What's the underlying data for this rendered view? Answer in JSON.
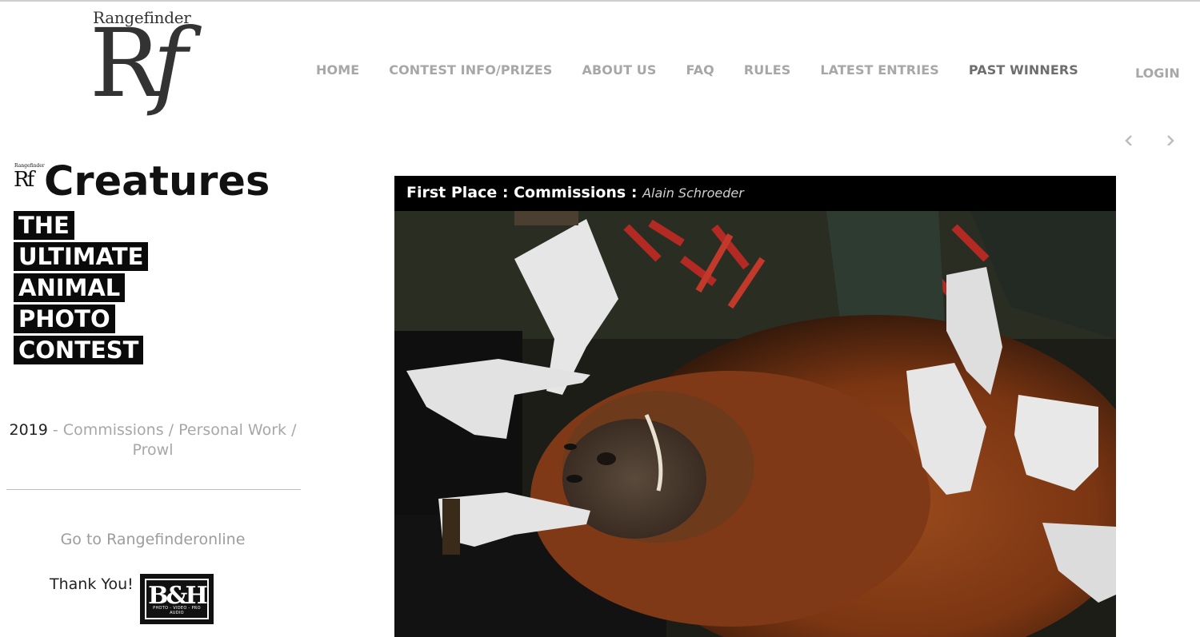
{
  "logo": {
    "word": "Rangefinder",
    "mark_r": "R",
    "mark_f": "f"
  },
  "nav": {
    "items": [
      "HOME",
      "CONTEST INFO/PRIZES",
      "ABOUT US",
      "FAQ",
      "RULES",
      "LATEST ENTRIES",
      "PAST WINNERS"
    ],
    "active": "PAST WINNERS",
    "login": "LOGIN"
  },
  "slider": {
    "prev_icon": "chevron-left-icon",
    "next_icon": "chevron-right-icon"
  },
  "badge": {
    "small_word": "Rangefinder",
    "small_mark": "Rf",
    "title": "Creatures",
    "lines": [
      "THE",
      "ULTIMATE",
      "ANIMAL",
      "PHOTO",
      "CONTEST"
    ]
  },
  "sidebar": {
    "year": "2019",
    "sep": " - ",
    "links": [
      "Commissions",
      "Personal Work",
      "Prowl"
    ],
    "goto": "Go to Rangefinderonline",
    "thanks": "Thank You!",
    "sponsor_logo": "B&H",
    "sponsor_tagline": "PHOTO - VIDEO - PRO AUDIO"
  },
  "photo": {
    "caption_place": "First Place",
    "caption_sep": " : ",
    "caption_category": "Commissions",
    "caption_author": "Alain Schroeder"
  },
  "colors": {
    "nav": "#a7a7a7",
    "nav_active": "#6e6e6e",
    "caption_bg": "#000000"
  }
}
